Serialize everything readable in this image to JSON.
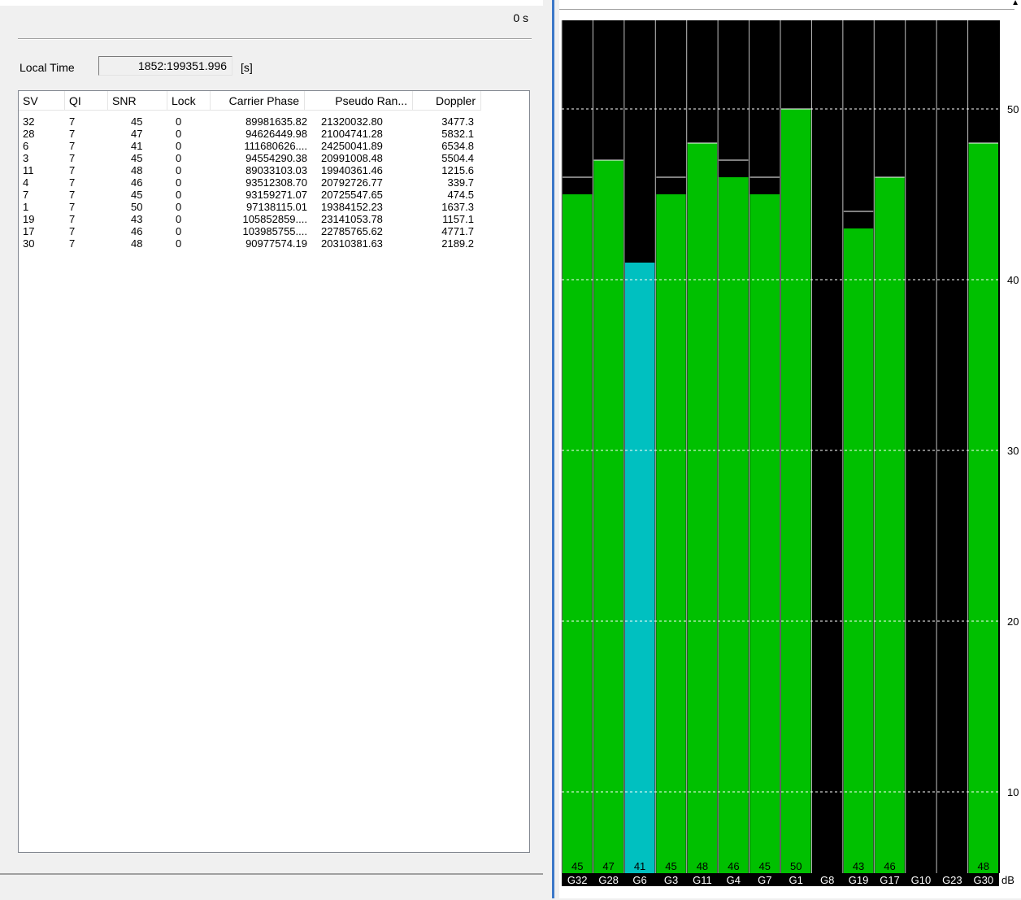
{
  "header": {
    "elapsed": "0 s",
    "local_time_label": "Local Time",
    "local_time_value": "1852:199351.996",
    "local_time_unit": "[s]"
  },
  "table": {
    "columns": [
      "SV",
      "QI",
      "SNR",
      "Lock",
      "Carrier Phase",
      "Pseudo Ran...",
      "Doppler"
    ],
    "rows": [
      [
        "32",
        "7",
        "45",
        "0",
        "89981635.82",
        "21320032.80",
        "3477.3"
      ],
      [
        "28",
        "7",
        "47",
        "0",
        "94626449.98",
        "21004741.28",
        "5832.1"
      ],
      [
        "6",
        "7",
        "41",
        "0",
        "111680626....",
        "24250041.89",
        "6534.8"
      ],
      [
        "3",
        "7",
        "45",
        "0",
        "94554290.38",
        "20991008.48",
        "5504.4"
      ],
      [
        "11",
        "7",
        "48",
        "0",
        "89033103.03",
        "19940361.46",
        "1215.6"
      ],
      [
        "4",
        "7",
        "46",
        "0",
        "93512308.70",
        "20792726.77",
        "339.7"
      ],
      [
        "7",
        "7",
        "45",
        "0",
        "93159271.07",
        "20725547.65",
        "474.5"
      ],
      [
        "1",
        "7",
        "50",
        "0",
        "97138115.01",
        "19384152.23",
        "1637.3"
      ],
      [
        "19",
        "7",
        "43",
        "0",
        "105852859....",
        "23141053.78",
        "1157.1"
      ],
      [
        "17",
        "7",
        "46",
        "0",
        "103985755....",
        "22785765.62",
        "4771.7"
      ],
      [
        "30",
        "7",
        "48",
        "0",
        "90977574.19",
        "20310381.63",
        "2189.2"
      ]
    ]
  },
  "chart_data": {
    "type": "bar",
    "categories": [
      "G32",
      "G28",
      "G6",
      "G3",
      "G11",
      "G4",
      "G7",
      "G1",
      "G8",
      "G19",
      "G17",
      "G10",
      "G23",
      "G30"
    ],
    "values": [
      45,
      47,
      41,
      45,
      48,
      46,
      45,
      50,
      null,
      43,
      46,
      null,
      null,
      48
    ],
    "value_labels": [
      "45",
      "47",
      "41",
      "45",
      "48",
      "46",
      "45",
      "50",
      "",
      "43",
      "46",
      "",
      "",
      "48"
    ],
    "peak_markers": [
      46,
      47,
      null,
      46,
      48,
      47,
      46,
      50,
      null,
      44,
      46,
      null,
      null,
      48
    ],
    "highlight_index": 2,
    "y_ticks": [
      "10",
      "20",
      "30",
      "40",
      "50"
    ],
    "y_unit": "dB",
    "ylim": [
      0,
      55
    ],
    "grid": true,
    "colors": {
      "bar": "#00c000",
      "highlight": "#00c0c0",
      "background": "#000000",
      "grid": "#ffffff",
      "text": "#000000"
    }
  }
}
